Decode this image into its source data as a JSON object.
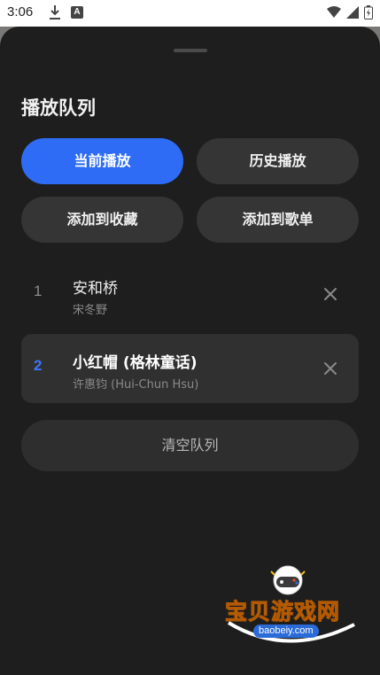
{
  "status_bar": {
    "time": "3:06",
    "download_icon": "download-icon",
    "notification_letter": "A",
    "icons": [
      "wifi-icon",
      "signal-icon",
      "battery-icon"
    ]
  },
  "sheet": {
    "title": "播放队列",
    "tabs": [
      {
        "label": "当前播放",
        "active": true
      },
      {
        "label": "历史播放",
        "active": false
      }
    ],
    "actions": [
      {
        "label": "添加到收藏"
      },
      {
        "label": "添加到歌单"
      }
    ],
    "queue": [
      {
        "index": "1",
        "title": "安和桥",
        "artist": "宋冬野",
        "playing": false
      },
      {
        "index": "2",
        "title": "小红帽 (格林童话)",
        "artist": "许惠钧 (Hui-Chun Hsu)",
        "playing": true
      }
    ],
    "clear_label": "清空队列"
  },
  "watermark": {
    "text": "宝贝游戏网",
    "url": "baobeiy.com"
  },
  "colors": {
    "accent": "#2f6cf5",
    "sheet_bg": "#1e1e1e",
    "button_bg": "#353535",
    "playing_index": "#3b77ff"
  }
}
